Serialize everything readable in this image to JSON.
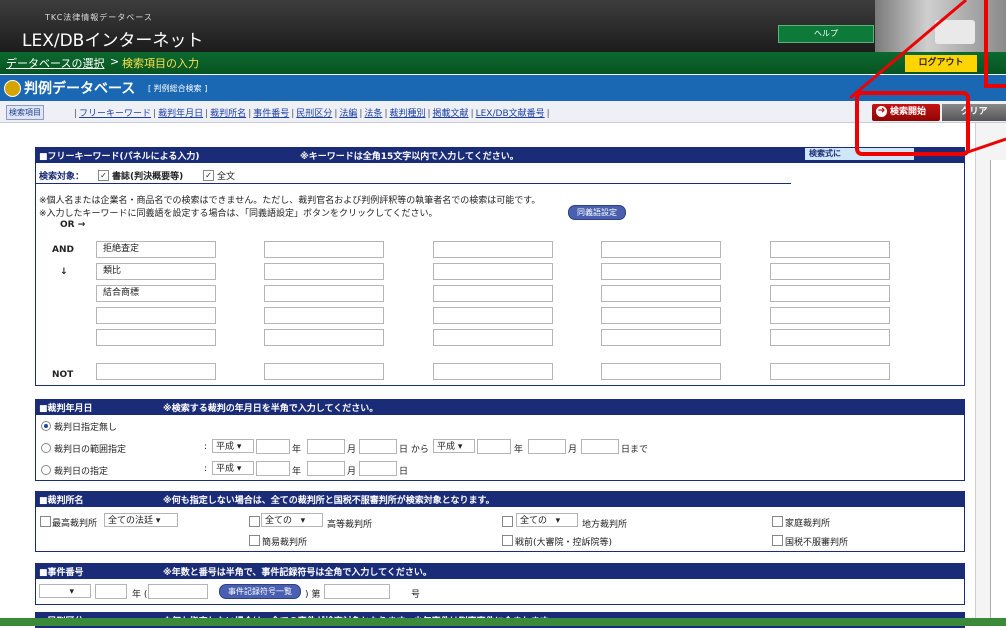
{
  "header": {
    "subtitle": "TKC法律情報データベース",
    "logo": "LEX/DBインターネット",
    "help_label": "ヘルプ",
    "logout_label": "ログアウト"
  },
  "breadcrumb": {
    "link": "データベースの選択",
    "sep": ">",
    "current": "検索項目の入力"
  },
  "db": {
    "title": "判例データベース",
    "subtitle": "[ 判例総合検索 ]"
  },
  "tabs": {
    "label": "検索項目",
    "items": [
      "フリーキーワード",
      "裁判年月日",
      "裁判所名",
      "事件番号",
      "民刑区分",
      "法編",
      "法条",
      "裁判種別",
      "掲載文献",
      "LEX/DB文献番号"
    ]
  },
  "actions": {
    "start_label": "検索開始",
    "clear_label": "クリア"
  },
  "keyword": {
    "title": "■フリーキーワード(パネルによる入力)",
    "note": "※キーワードは全角15文字以内で入力してください。",
    "formula_button": "検索式に",
    "target_label": "検索対象：",
    "opt_books": "書誌(判決概要等)",
    "opt_fulltext": "全文",
    "notice1": "※個人名または企業名・商品名での検索はできません。ただし、裁判官名および判例評釈等の執筆者名での検索は可能です。",
    "notice2": "※入力したキーワードに同義語を設定する場合は、「同義語設定」ボタンをクリックしてください。",
    "synonym_button": "同義語設定",
    "or_label": "OR →",
    "and_label": "AND",
    "down_arrow": "↓",
    "not_label": "NOT",
    "values": [
      "拒絶査定",
      "類比",
      "結合商標"
    ]
  },
  "date": {
    "title": "■裁判年月日",
    "note": "※検索する裁判の年月日を半角で入力してください。",
    "opt_none": "裁判日指定無し",
    "opt_range": "裁判日の範囲指定",
    "opt_exact": "裁判日の指定",
    "colon": ":",
    "era": "平成",
    "year": "年",
    "month": "月",
    "day_from": "日 から",
    "day_to": "日まで",
    "day": "日"
  },
  "court": {
    "title": "■裁判所名",
    "note": "※何も指定しない場合は、全ての裁判所と国税不服審判所が検索対象となります。",
    "supreme": "最高裁判所",
    "supreme_sel": "全ての法廷",
    "all": "全ての",
    "high": "高等裁判所",
    "district": "地方裁判所",
    "family": "家庭裁判所",
    "summary": "簡易裁判所",
    "prewar": "戦前(大審院・控訴院等)",
    "tax": "国税不服審判所"
  },
  "case": {
    "title": "■事件番号",
    "note": "※年数と番号は半角で、事件記録符号は全角で入力してください。",
    "year_label": "年 (",
    "code_button": "事件記録符号一覧",
    "dai": ") 第",
    "go": "号"
  },
  "criminal": {
    "title": "■民刑区分",
    "note": "※何も指定しない場合は、全ての事件が検索対象となります。少年事件は刑事事件に含まれます。"
  },
  "colors": {
    "header_dark": "#1c1c1c",
    "nav_green": "#08531f",
    "title_blue": "#1a67b3",
    "section_navy": "#1a2b77",
    "start_red": "#c61414",
    "logout_yellow": "#ffd400",
    "annotation_red": "#ee0000"
  }
}
